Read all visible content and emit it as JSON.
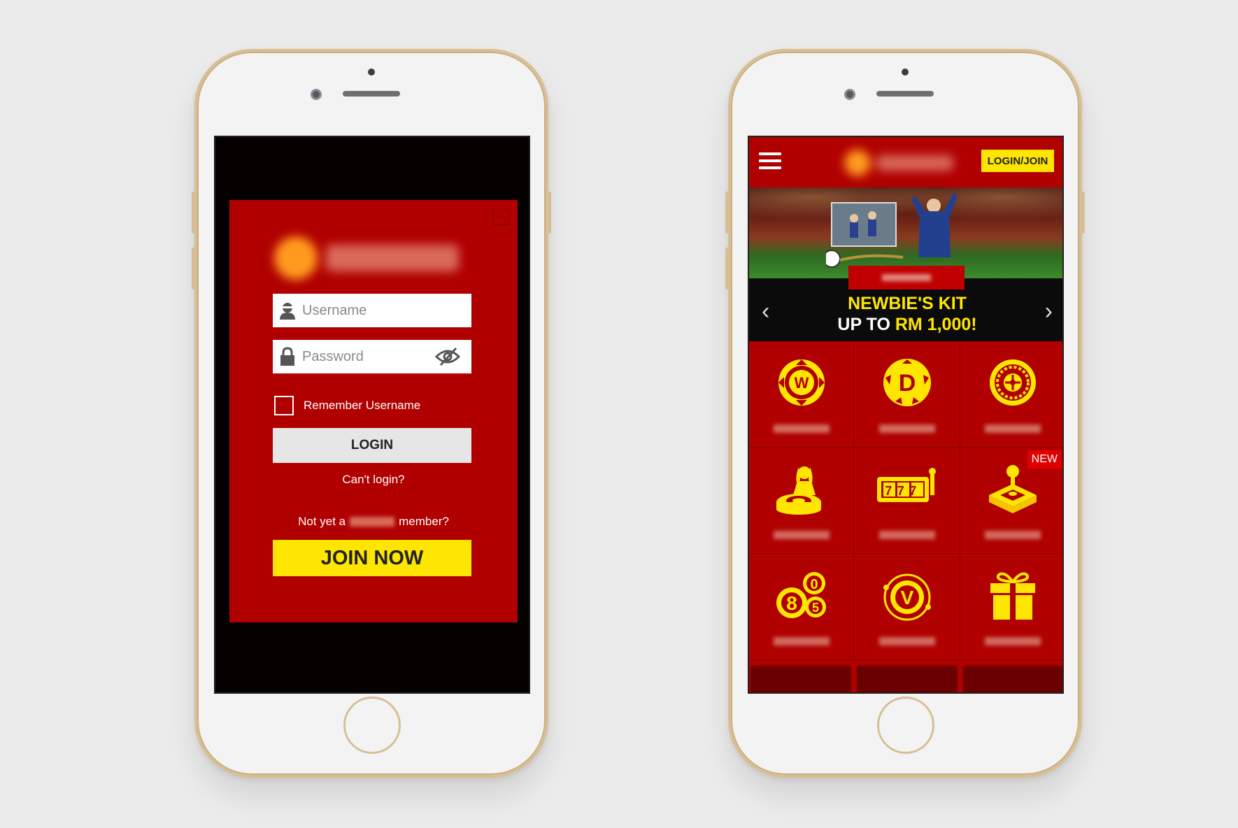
{
  "left_phone": {
    "login_modal": {
      "close_icon": "close-icon",
      "username_placeholder": "Username",
      "password_placeholder": "Password",
      "remember_label": "Remember Username",
      "login_button": "LOGIN",
      "cant_login": "Can't login?",
      "not_yet_prefix": "Not yet a",
      "not_yet_suffix": "member?",
      "join_button": "JOIN NOW"
    }
  },
  "right_phone": {
    "header": {
      "menu_icon": "hamburger-icon",
      "login_join_button": "LOGIN/JOIN"
    },
    "banner": {
      "line1": "NEWBIE'S KIT",
      "line2_prefix": "UP TO",
      "line2_highlight": "RM 1,000!"
    },
    "grid_items": [
      {
        "icon": "w-sports-icon"
      },
      {
        "icon": "d-sports-icon"
      },
      {
        "icon": "casino-roulette-icon"
      },
      {
        "icon": "live-dealer-icon"
      },
      {
        "icon": "slot-777-icon"
      },
      {
        "icon": "arcade-joystick-icon",
        "badge": "NEW"
      },
      {
        "icon": "lottery-balls-icon",
        "balls": [
          "8",
          "0",
          "5"
        ]
      },
      {
        "icon": "virtuals-icon",
        "letter": "V"
      },
      {
        "icon": "gift-icon"
      }
    ],
    "sport_letters": {
      "w": "W",
      "d": "D"
    },
    "slot_digits": "777"
  },
  "colors": {
    "brand_red": "#b00000",
    "accent_yellow": "#ffe600",
    "phone_gold": "#d7bf95"
  }
}
